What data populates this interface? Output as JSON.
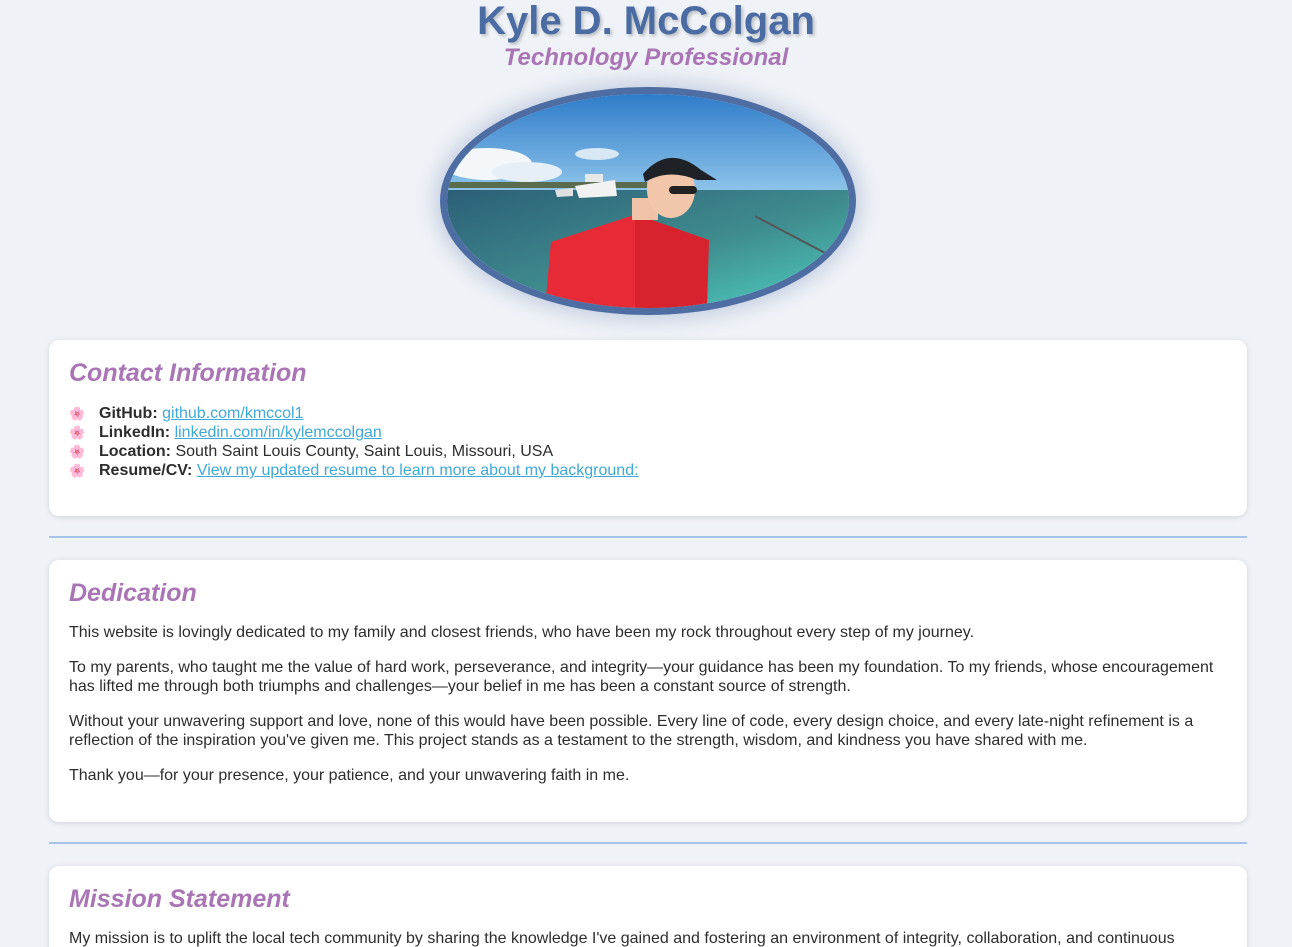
{
  "header": {
    "name": "Kyle D. McColgan",
    "title": "Technology Professional"
  },
  "profile_photo": {
    "alt": "Kyle D. McColgan"
  },
  "contact": {
    "heading": "Contact Information",
    "bullet_icon": "cherry-blossom",
    "items": [
      {
        "label": "GitHub:",
        "value": "github.com/kmccol1",
        "is_link": true
      },
      {
        "label": "LinkedIn:",
        "value": "linkedin.com/in/kylemccolgan",
        "is_link": true
      },
      {
        "label": "Location:",
        "value": "South Saint Louis County, Saint Louis, Missouri, USA",
        "is_link": false
      },
      {
        "label": "Resume/CV:",
        "value": "View my updated resume to learn more about my background:",
        "is_link": true
      }
    ]
  },
  "dedication": {
    "heading": "Dedication",
    "paragraphs": [
      "This website is lovingly dedicated to my family and closest friends, who have been my rock throughout every step of my journey.",
      "To my parents, who taught me the value of hard work, perseverance, and integrity—your guidance has been my foundation. To my friends, whose encouragement has lifted me through both triumphs and challenges—your belief in me has been a constant source of strength.",
      "Without your unwavering support and love, none of this would have been possible. Every line of code, every design choice, and every late-night refinement is a reflection of the inspiration you've given me. This project stands as a testament to the strength, wisdom, and kindness you have shared with me.",
      "Thank you—for your presence, your patience, and your unwavering faith in me."
    ]
  },
  "mission": {
    "heading": "Mission Statement",
    "paragraphs": [
      "My mission is to uplift the local tech community by sharing the knowledge I've gained and fostering an environment of integrity, collaboration, and continuous"
    ]
  },
  "colors": {
    "name": "#4a6ca3",
    "accent": "#a975b5",
    "link": "#3fa9d8",
    "divider": "#a8c4ea",
    "background": "#eff2f7"
  }
}
